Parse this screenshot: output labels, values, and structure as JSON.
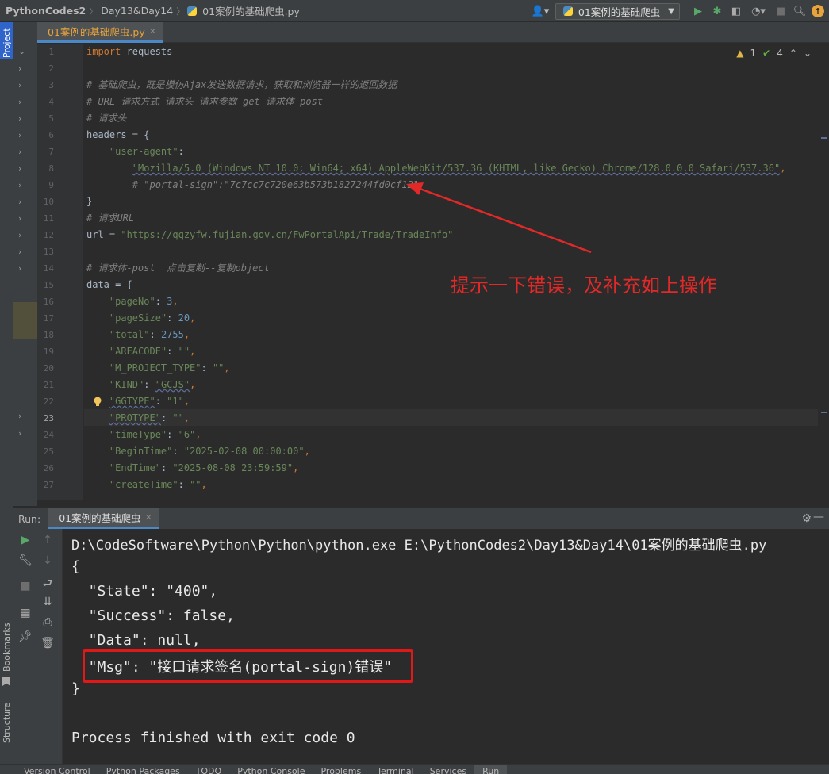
{
  "breadcrumbs": [
    "PythonCodes2",
    "Day13&Day14",
    "01案例的基础爬虫.py"
  ],
  "toolbar": {
    "run_config_label": "01案例的基础爬虫",
    "icons": [
      "user-icon",
      "run-icon",
      "debug-icon",
      "coverage-icon",
      "profile-icon",
      "search-icon",
      "update-icon"
    ]
  },
  "side_tabs": {
    "project": "Project",
    "bookmarks": "Bookmarks",
    "structure": "Structure"
  },
  "editor": {
    "tab_label": "01案例的基础爬虫.py",
    "inspection": {
      "warnings": "1",
      "weak_warnings": "4"
    },
    "lines": [
      {
        "n": "1",
        "tokens": [
          {
            "t": "import",
            "c": "kw"
          },
          {
            "t": " requests",
            "c": "pl"
          }
        ]
      },
      {
        "n": "2",
        "tokens": []
      },
      {
        "n": "3",
        "tokens": [
          {
            "t": "# 基础爬虫，既是模仿Ajax发送数据请求，获取和浏览器一样的返回数据",
            "c": "com"
          }
        ]
      },
      {
        "n": "4",
        "tokens": [
          {
            "t": "# URL 请求方式 请求头 请求参数-get 请求体-post",
            "c": "com"
          }
        ]
      },
      {
        "n": "5",
        "tokens": [
          {
            "t": "# 请求头",
            "c": "com"
          }
        ]
      },
      {
        "n": "6",
        "tokens": [
          {
            "t": "headers = {",
            "c": "pl"
          }
        ]
      },
      {
        "n": "7",
        "tokens": [
          {
            "t": "    ",
            "c": "pl"
          },
          {
            "t": "\"user-agent\"",
            "c": "str"
          },
          {
            "t": ":",
            "c": "pl"
          }
        ]
      },
      {
        "n": "8",
        "tokens": [
          {
            "t": "        ",
            "c": "pl"
          },
          {
            "t": "\"Mozilla/5.0 (Windows NT 10.0; Win64; x64) AppleWebKit/537.36 (KHTML, like Gecko) Chrome/128.0.0.0 Safari/537.36\"",
            "c": "str wavy"
          },
          {
            "t": ",",
            "c": "kw"
          }
        ]
      },
      {
        "n": "9",
        "tokens": [
          {
            "t": "        ",
            "c": "pl"
          },
          {
            "t": "# \"portal-sign\":\"7c7cc7c720e63b573b1827244fd0cf12\"",
            "c": "com"
          }
        ]
      },
      {
        "n": "10",
        "tokens": [
          {
            "t": "}",
            "c": "pl"
          }
        ]
      },
      {
        "n": "11",
        "tokens": [
          {
            "t": "# 请求URL",
            "c": "com"
          }
        ]
      },
      {
        "n": "12",
        "tokens": [
          {
            "t": "url = ",
            "c": "pl"
          },
          {
            "t": "\"",
            "c": "str"
          },
          {
            "t": "https://qqzyfw.fujian.gov.cn/FwPortalApi/Trade/TradeInfo",
            "c": "str uline"
          },
          {
            "t": "\"",
            "c": "str"
          }
        ]
      },
      {
        "n": "13",
        "tokens": []
      },
      {
        "n": "14",
        "tokens": [
          {
            "t": "# 请求体-post  点击复制--复制object",
            "c": "com"
          }
        ]
      },
      {
        "n": "15",
        "tokens": [
          {
            "t": "data = {",
            "c": "pl"
          }
        ]
      },
      {
        "n": "16",
        "tokens": [
          {
            "t": "    ",
            "c": "pl"
          },
          {
            "t": "\"pageNo\"",
            "c": "str"
          },
          {
            "t": ": ",
            "c": "pl"
          },
          {
            "t": "3",
            "c": "num"
          },
          {
            "t": ",",
            "c": "kw"
          }
        ]
      },
      {
        "n": "17",
        "tokens": [
          {
            "t": "    ",
            "c": "pl"
          },
          {
            "t": "\"pageSize\"",
            "c": "str"
          },
          {
            "t": ": ",
            "c": "pl"
          },
          {
            "t": "20",
            "c": "num"
          },
          {
            "t": ",",
            "c": "kw"
          }
        ]
      },
      {
        "n": "18",
        "tokens": [
          {
            "t": "    ",
            "c": "pl"
          },
          {
            "t": "\"total\"",
            "c": "str"
          },
          {
            "t": ": ",
            "c": "pl"
          },
          {
            "t": "2755",
            "c": "num"
          },
          {
            "t": ",",
            "c": "kw"
          }
        ]
      },
      {
        "n": "19",
        "tokens": [
          {
            "t": "    ",
            "c": "pl"
          },
          {
            "t": "\"AREACODE\"",
            "c": "str"
          },
          {
            "t": ": ",
            "c": "pl"
          },
          {
            "t": "\"\"",
            "c": "str"
          },
          {
            "t": ",",
            "c": "kw"
          }
        ]
      },
      {
        "n": "20",
        "tokens": [
          {
            "t": "    ",
            "c": "pl"
          },
          {
            "t": "\"M_PROJECT_TYPE\"",
            "c": "str"
          },
          {
            "t": ": ",
            "c": "pl"
          },
          {
            "t": "\"\"",
            "c": "str"
          },
          {
            "t": ",",
            "c": "kw"
          }
        ]
      },
      {
        "n": "21",
        "tokens": [
          {
            "t": "    ",
            "c": "pl"
          },
          {
            "t": "\"KIND\"",
            "c": "str"
          },
          {
            "t": ": ",
            "c": "pl"
          },
          {
            "t": "\"GCJS\"",
            "c": "str wavy"
          },
          {
            "t": ",",
            "c": "kw"
          }
        ]
      },
      {
        "n": "22",
        "tokens": [
          {
            "t": "    ",
            "c": "pl"
          },
          {
            "t": "\"GGTYPE\"",
            "c": "str wavy"
          },
          {
            "t": ": ",
            "c": "pl"
          },
          {
            "t": "\"1\"",
            "c": "str"
          },
          {
            "t": ",",
            "c": "kw"
          }
        ]
      },
      {
        "n": "23",
        "tokens": [
          {
            "t": "    ",
            "c": "pl"
          },
          {
            "t": "\"PROTYPE\"",
            "c": "str wavy"
          },
          {
            "t": ": ",
            "c": "pl"
          },
          {
            "t": "\"\"",
            "c": "str"
          },
          {
            "t": ",",
            "c": "kw"
          }
        ]
      },
      {
        "n": "24",
        "tokens": [
          {
            "t": "    ",
            "c": "pl"
          },
          {
            "t": "\"timeType\"",
            "c": "str"
          },
          {
            "t": ": ",
            "c": "pl"
          },
          {
            "t": "\"6\"",
            "c": "str"
          },
          {
            "t": ",",
            "c": "kw"
          }
        ]
      },
      {
        "n": "25",
        "tokens": [
          {
            "t": "    ",
            "c": "pl"
          },
          {
            "t": "\"BeginTime\"",
            "c": "str"
          },
          {
            "t": ": ",
            "c": "pl"
          },
          {
            "t": "\"2025-02-08 00:00:00\"",
            "c": "str"
          },
          {
            "t": ",",
            "c": "kw"
          }
        ]
      },
      {
        "n": "26",
        "tokens": [
          {
            "t": "    ",
            "c": "pl"
          },
          {
            "t": "\"EndTime\"",
            "c": "str"
          },
          {
            "t": ": ",
            "c": "pl"
          },
          {
            "t": "\"2025-08-08 23:59:59\"",
            "c": "str"
          },
          {
            "t": ",",
            "c": "kw"
          }
        ]
      },
      {
        "n": "27",
        "tokens": [
          {
            "t": "    ",
            "c": "pl"
          },
          {
            "t": "\"createTime\"",
            "c": "str"
          },
          {
            "t": ": ",
            "c": "pl"
          },
          {
            "t": "\"\"",
            "c": "str"
          },
          {
            "t": ",",
            "c": "kw"
          }
        ]
      }
    ],
    "current_line": "23"
  },
  "annotation": {
    "text": "提示一下错误，及补充如上操作",
    "color": "#e32828"
  },
  "run_panel": {
    "label": "Run:",
    "tab_label": "01案例的基础爬虫",
    "output": [
      "D:\\CodeSoftware\\Python\\Python\\python.exe E:\\PythonCodes2\\Day13&Day14\\01案例的基础爬虫.py",
      "{",
      "  \"State\": \"400\",",
      "  \"Success\": false,",
      "  \"Data\": null,",
      "  \"Msg\": \"接口请求签名(portal-sign)错误\"",
      "}",
      "",
      "Process finished with exit code 0"
    ]
  },
  "statusbar": {
    "items": [
      "Version Control",
      "Python Packages",
      "TODO",
      "Python Console",
      "Problems",
      "Terminal",
      "Services",
      "Run"
    ]
  },
  "colors": {
    "accent": "#4a88c7",
    "keyword": "#cc7832",
    "string": "#6a8759",
    "number": "#6897bb",
    "comment": "#808080",
    "highlight_box": "#e01818"
  }
}
